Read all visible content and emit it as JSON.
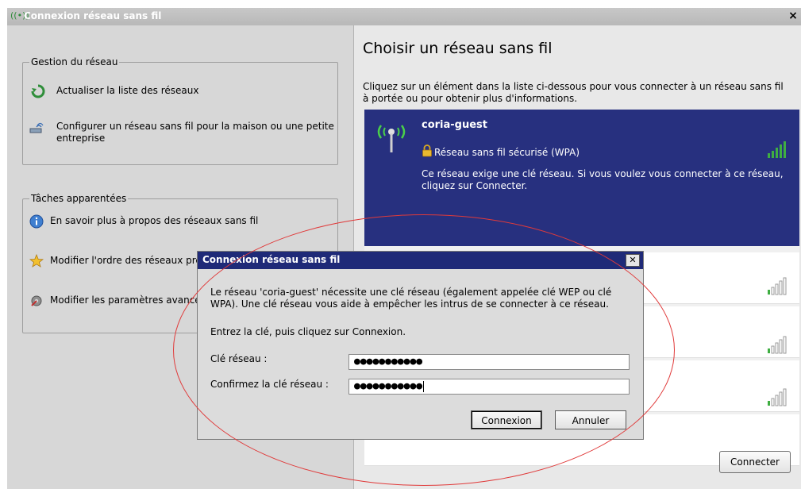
{
  "window": {
    "title": "Connexion réseau sans fil",
    "close_glyph": "×"
  },
  "left": {
    "groups": [
      {
        "legend": "Gestion du réseau",
        "tasks": [
          {
            "label": "Actualiser la liste des réseaux",
            "icon": "refresh-icon"
          },
          {
            "label": "Configurer un réseau sans fil pour la maison ou une petite entreprise",
            "icon": "setup-network-icon"
          }
        ]
      },
      {
        "legend": "Tâches apparentées",
        "tasks": [
          {
            "label": "En savoir plus à propos des réseaux sans fil",
            "icon": "info-icon"
          },
          {
            "label": "Modifier l'ordre des réseaux préférés",
            "icon": "star-icon"
          },
          {
            "label": "Modifier les paramètres avancés",
            "icon": "settings-icon"
          }
        ]
      }
    ]
  },
  "right": {
    "heading": "Choisir un réseau sans fil",
    "description": "Cliquez sur un élément dans la liste ci-dessous pour vous connecter à un réseau sans fil à portée ou pour obtenir plus d'informations.",
    "selected_network": {
      "name": "coria-guest",
      "security": "Réseau sans fil sécurisé (WPA)",
      "message": "Ce réseau exige une clé réseau. Si vous voulez vous connecter à ce réseau, cliquez sur Connecter.",
      "signal_bars": 5
    },
    "other_networks": [
      {
        "signal_bars": 1
      },
      {
        "signal_bars": 1
      },
      {
        "signal_bars": 1
      },
      {
        "signal_bars": 1
      }
    ],
    "connect_label": "Connecter"
  },
  "dialog": {
    "title": "Connexion réseau sans fil",
    "close_glyph": "✕",
    "message": "Le réseau 'coria-guest' nécessite une clé réseau (également appelée clé WEP ou clé WPA). Une clé réseau vous aide à empêcher les intrus de se connecter à ce réseau.",
    "instruction": "Entrez la clé, puis cliquez sur Connexion.",
    "key_label": "Clé réseau :",
    "key_value": "●●●●●●●●●●●",
    "confirm_label": "Confirmez la clé réseau :",
    "confirm_value": "●●●●●●●●●●●",
    "connect_button": "Connexion",
    "cancel_button": "Annuler"
  },
  "colors": {
    "selected_bg": "#27307f",
    "dialog_title_bg": "#1f2a78",
    "signal_green": "#2f9e35",
    "annotation_red": "#e03a3a"
  }
}
